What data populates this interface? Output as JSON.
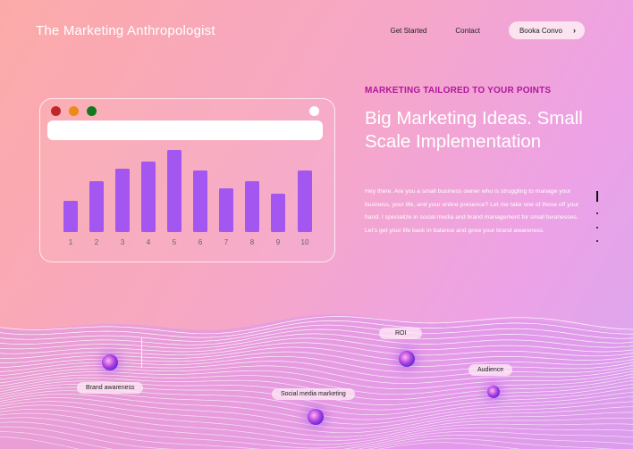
{
  "header": {
    "brand": "The Marketing Anthropologist",
    "nav": [
      "Get Started",
      "Contact"
    ],
    "cta_label": "Booka Convo",
    "cta_icon": "chevron-right-icon"
  },
  "hero": {
    "eyebrow": "MARKETING TAILORED TO YOUR POINTS",
    "headline": "Big Marketing Ideas. Small Scale Implementation",
    "body": "Hey there. Are you a small business owner who is struggling to manage your business, your life, and your online presence? Let me take one of those off your hand. I specialize in social media and brand management for small businesses. Let's get your life back in balance and grow your brand awareness."
  },
  "chart_data": {
    "type": "bar",
    "categories": [
      "1",
      "2",
      "3",
      "4",
      "5",
      "6",
      "7",
      "8",
      "9",
      "10"
    ],
    "values": [
      35,
      57,
      71,
      79,
      92,
      69,
      49,
      57,
      43,
      69
    ],
    "ylim": [
      0,
      100
    ],
    "colors": {
      "bar": "#a357f0"
    }
  },
  "features": {
    "labels": [
      "Brand awareness",
      "Social media marketing",
      "ROI",
      "Audience"
    ]
  },
  "colors": {
    "accent": "#b0179b",
    "bar": "#a357f0"
  }
}
